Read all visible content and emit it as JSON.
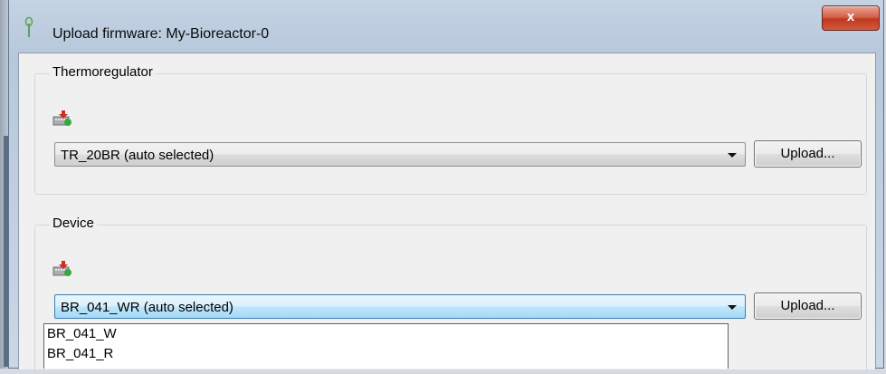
{
  "window": {
    "title": "Upload firmware: My-Bioreactor-0",
    "close_label": "x"
  },
  "thermoregulator": {
    "legend": "Thermoregulator",
    "selected": "TR_20BR (auto selected)",
    "upload_label": "Upload..."
  },
  "device": {
    "legend": "Device",
    "selected": "BR_041_WR (auto selected)",
    "upload_label": "Upload...",
    "options": [
      "BR_041_W",
      "BR_041_R"
    ]
  },
  "icons": {
    "app": "plant-icon",
    "firmware": "firmware-download-icon",
    "dropdown": "chevron-down-icon"
  }
}
